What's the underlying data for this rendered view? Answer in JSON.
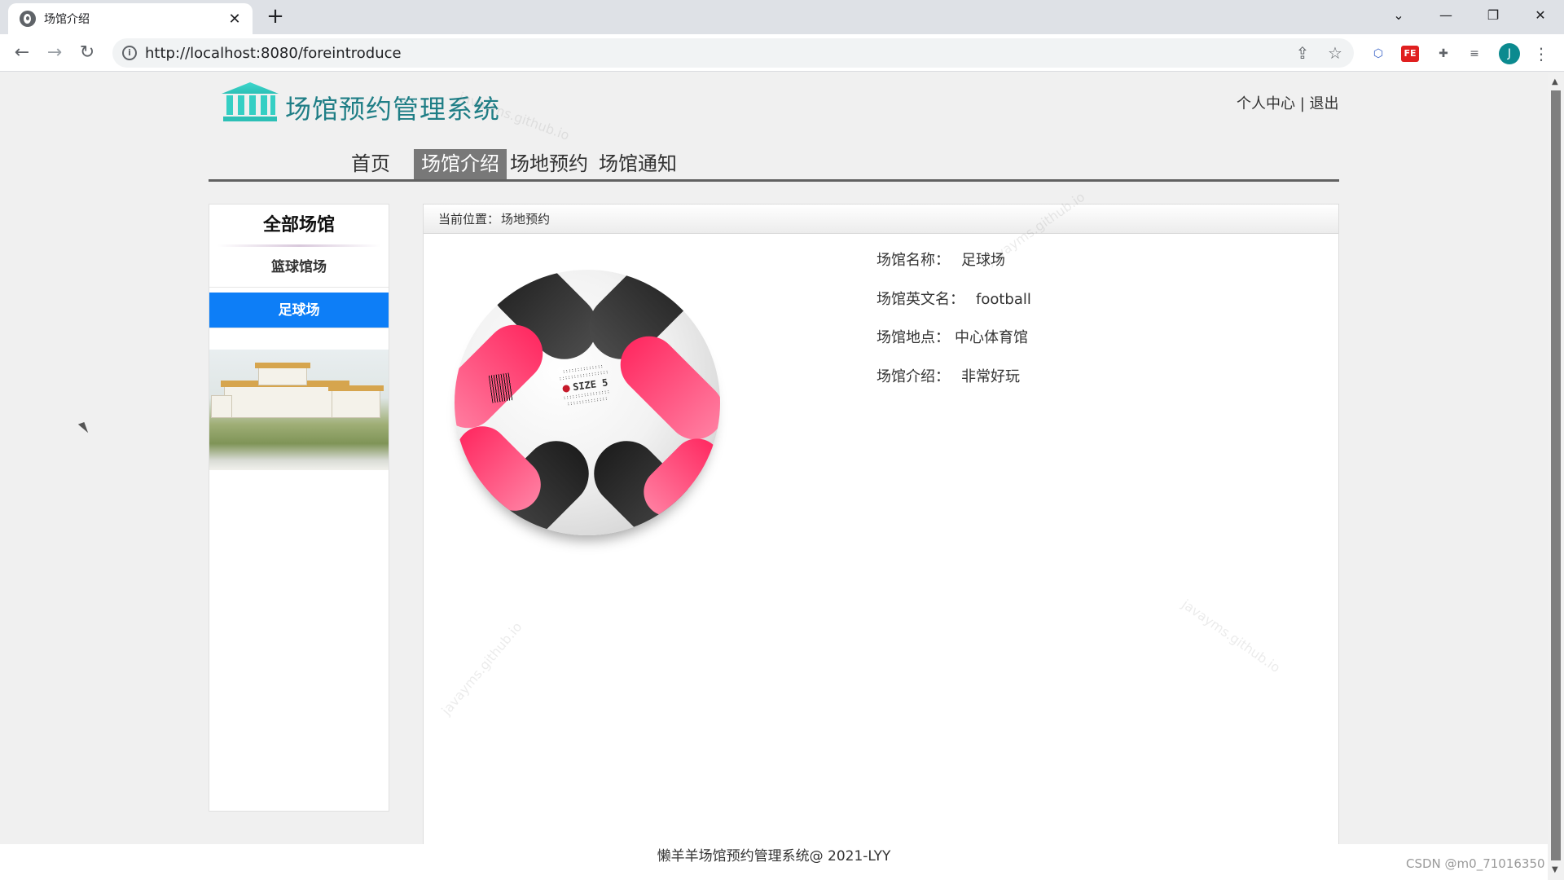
{
  "browser": {
    "tab_title": "场馆介绍",
    "tab_close": "✕",
    "new_tab": "+",
    "url": "http://localhost:8080/foreintroduce",
    "avatar_letter": "J"
  },
  "header": {
    "site_title": "场馆预约管理系统",
    "personal_center": "个人中心",
    "separator": " | ",
    "logout": "退出"
  },
  "nav": {
    "items": [
      {
        "label": "首页",
        "active": false
      },
      {
        "label": "场馆介绍",
        "active": true
      },
      {
        "label": "场地预约",
        "active": false
      },
      {
        "label": "场馆通知",
        "active": false
      }
    ]
  },
  "sidebar": {
    "title": "全部场馆",
    "items": [
      {
        "label": "篮球馆场",
        "active": false
      },
      {
        "label": "足球场",
        "active": true
      }
    ]
  },
  "breadcrumb": {
    "prefix": "当前位置：",
    "current": "场地预约"
  },
  "venue": {
    "fields": [
      {
        "label": "场馆名称：",
        "value": "足球场"
      },
      {
        "label": "场馆英文名：",
        "value": "football"
      },
      {
        "label": "场馆地点：",
        "value": "中心体育馆"
      },
      {
        "label": "场馆介绍：",
        "value": "非常好玩"
      }
    ],
    "ball_size_text": "SIZE 5"
  },
  "watermark_text": "javayms.github.io",
  "footer": {
    "text": "懒羊羊场馆预约管理系统@ 2021-LYY"
  },
  "credit": "CSDN @m0_71016350",
  "colors": {
    "active_nav_bg": "#787878",
    "active_side_bg": "#0d7ef7",
    "title_color": "#1f7e86"
  }
}
